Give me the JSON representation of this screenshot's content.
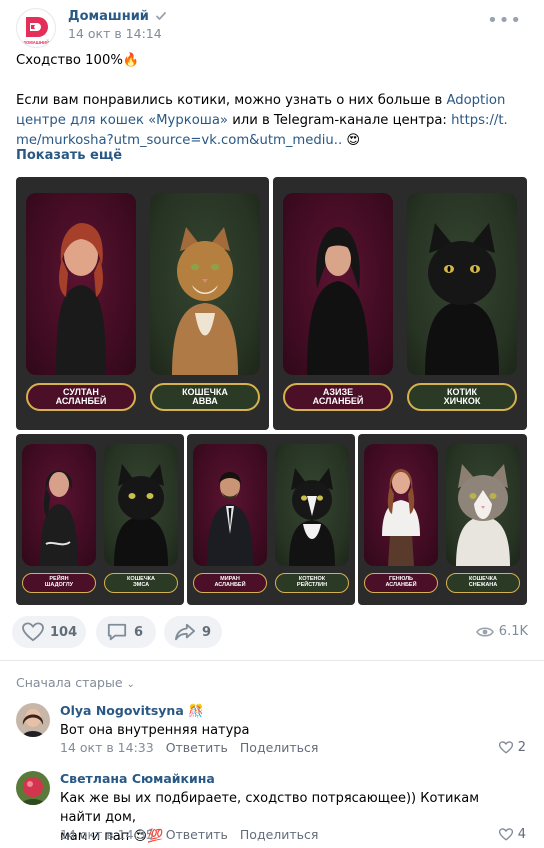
{
  "group": {
    "name": "Домашний",
    "logo_text": "ДОМАШНИЙ",
    "date": "14 окт в 14:14"
  },
  "post": {
    "line1": "Сходство 100%🔥",
    "line2_a": "Если вам понравились котики, можно узнать о них больше в ",
    "line2_link": "Adoption центре для кошек «Муркоша»",
    "line2_b": " или в Telegram-канале центра: ",
    "line2_url": "https://t.me/murkosha?utm_source=vk.com&utm_mediu..",
    "line2_emoji": " 😍",
    "show_more": "Показать ещё"
  },
  "collage": {
    "top_left": {
      "person": "СУЛТАН\nАСЛАНБЕЙ",
      "cat": "КОШЕЧКА\nАВВА"
    },
    "top_right": {
      "person": "АЗИЗЕ\nАСЛАНБЕЙ",
      "cat": "КОТИК\nХИЧКОК"
    },
    "bottom_1": {
      "person": "РЕЙЯН\nШАДОГЛУ",
      "cat": "КОШЕЧКА\nЭМСА"
    },
    "bottom_2": {
      "person": "МИРАН\nАСЛАНБЕЙ",
      "cat": "КОТЕНОК\nРЕЙСТЛИН"
    },
    "bottom_3": {
      "person": "ГЕНЮЛЬ\nАСЛАНБЕЙ",
      "cat": "КОШЕЧКА\nСНЕЖАНА"
    }
  },
  "actions": {
    "likes": "104",
    "comments": "6",
    "shares": "9",
    "views": "6.1K"
  },
  "comments_sort": "Сначала старые",
  "comments": [
    {
      "author": "Olya Nogovitsyna",
      "author_emoji": "🎊",
      "text": "Вот она внутренняя натура",
      "date": "14 окт в 14:33",
      "reply": "Ответить",
      "share": "Поделиться",
      "likes": "2"
    },
    {
      "author": "Светлана Сюмайкина",
      "text_1": "Как же вы их подбираете, сходство потрясающее)) Котикам найти дом,",
      "text_2": "мам и пап 😍💯",
      "date": "14 окт в 14:35",
      "reply": "Ответить",
      "share": "Поделиться",
      "likes": "4"
    }
  ],
  "colors": {
    "link": "#2a5885",
    "muted": "#818c99",
    "gold": "#d6b24e",
    "maroon": "#4b0f28",
    "olive": "#2a3a25"
  }
}
